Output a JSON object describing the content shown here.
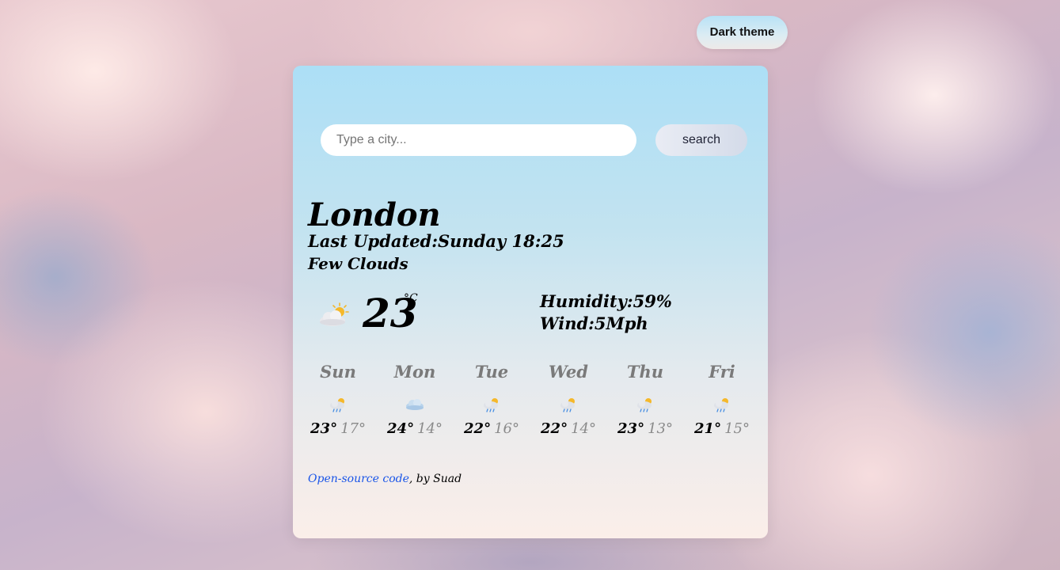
{
  "theme_toggle": {
    "label": "Dark theme"
  },
  "search": {
    "placeholder": "Type a city...",
    "button_label": "search"
  },
  "current": {
    "city": "London",
    "last_updated": "Last Updated:Sunday 18:25",
    "description": "Few Clouds",
    "icon": "few-clouds-icon",
    "temperature": "23",
    "unit": "°C",
    "humidity": "Humidity:59%",
    "wind": "Wind:5Mph"
  },
  "forecast": [
    {
      "day": "Sun",
      "max": "23°",
      "min": "17°",
      "icon": "rain-sun-icon"
    },
    {
      "day": "Mon",
      "max": "24°",
      "min": "14°",
      "icon": "cloud-icon"
    },
    {
      "day": "Tue",
      "max": "22°",
      "min": "16°",
      "icon": "rain-sun-icon"
    },
    {
      "day": "Wed",
      "max": "22°",
      "min": "14°",
      "icon": "rain-sun-icon"
    },
    {
      "day": "Thu",
      "max": "23°",
      "min": "13°",
      "icon": "rain-sun-icon"
    },
    {
      "day": "Fri",
      "max": "21°",
      "min": "15°",
      "icon": "rain-sun-icon"
    }
  ],
  "footer": {
    "link_text": "Open-source code",
    "suffix": ", by Suad"
  },
  "colors": {
    "card_top": "#acdff6",
    "card_bottom": "#fbeee9",
    "link": "#1a55e8",
    "min_temp": "#8a8a8a"
  }
}
